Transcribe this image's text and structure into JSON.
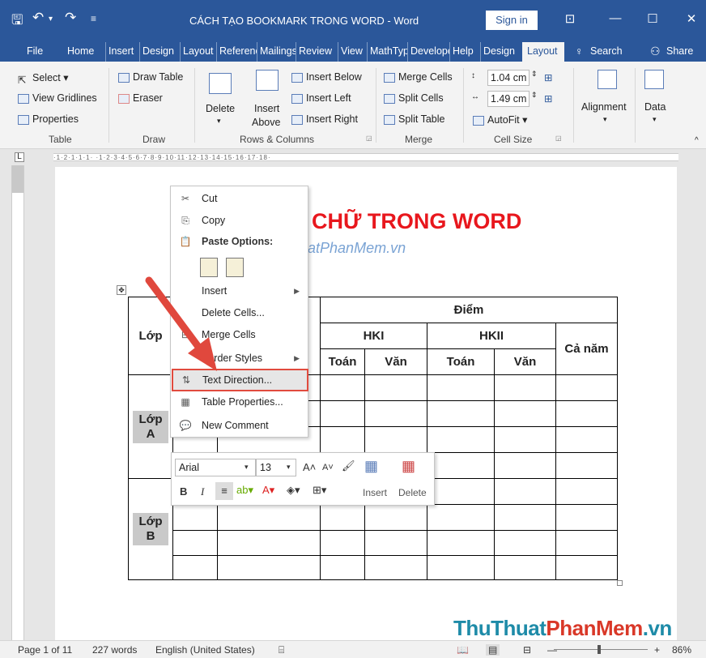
{
  "titlebar": {
    "title": "CÁCH TẠO BOOKMARK TRONG WORD  -  Word",
    "sign_in": "Sign in",
    "minimize": "☐",
    "close": "✕"
  },
  "tabs": [
    {
      "label": "File"
    },
    {
      "label": "Home"
    },
    {
      "label": "Insert"
    },
    {
      "label": "Design"
    },
    {
      "label": "Layout"
    },
    {
      "label": "References"
    },
    {
      "label": "Mailings"
    },
    {
      "label": "Review"
    },
    {
      "label": "View"
    },
    {
      "label": "MathType"
    },
    {
      "label": "Developer"
    },
    {
      "label": "Help"
    },
    {
      "label": "Design"
    },
    {
      "label": "Layout"
    }
  ],
  "tell_me": "Search",
  "share": "Share",
  "ribbon": {
    "table": {
      "select": "Select",
      "view_gridlines": "View Gridlines",
      "properties": "Properties",
      "group": "Table"
    },
    "draw": {
      "draw_table": "Draw Table",
      "eraser": "Eraser",
      "group": "Draw"
    },
    "rows_cols": {
      "delete": "Delete",
      "insert_above_1": "Insert",
      "insert_above_2": "Above",
      "insert_below": "Insert Below",
      "insert_left": "Insert Left",
      "insert_right": "Insert Right",
      "group": "Rows & Columns"
    },
    "merge": {
      "merge_cells": "Merge Cells",
      "split_cells": "Split Cells",
      "split_table": "Split Table",
      "group": "Merge"
    },
    "cell_size": {
      "height": "1.04 cm",
      "width": "1.49 cm",
      "autofit": "AutoFit",
      "group": "Cell Size"
    },
    "alignment": "Alignment",
    "data": "Data"
  },
  "document": {
    "heading": "Y CHỮ TRONG WORD",
    "subheading": "nuatPhanMem.vn",
    "table": {
      "lop": "Lớp",
      "diem": "Điểm",
      "hki": "HKI",
      "hkii": "HKII",
      "ca_nam": "Cả năm",
      "toan": "Toán",
      "van": "Văn",
      "lop_a": "Lớp A",
      "lop_b": "Lớp B"
    }
  },
  "context_menu": {
    "items": [
      {
        "label": "Cut",
        "icon": "scissors-icon"
      },
      {
        "label": "Copy",
        "icon": "copy-icon"
      },
      {
        "label": "Paste Options:",
        "icon": "paste-icon"
      },
      {
        "label": "Insert",
        "icon": ""
      },
      {
        "label": "Delete Cells...",
        "icon": ""
      },
      {
        "label": "Merge Cells",
        "icon": "merge-icon"
      },
      {
        "label": "Border Styles",
        "icon": ""
      },
      {
        "label": "Text Direction...",
        "icon": "text-direction-icon"
      },
      {
        "label": "Table Properties...",
        "icon": "table-properties-icon"
      },
      {
        "label": "New Comment",
        "icon": "comment-icon"
      }
    ]
  },
  "mini_toolbar": {
    "font": "Arial",
    "size": "13",
    "insert": "Insert",
    "delete": "Delete",
    "bold": "B",
    "italic": "I"
  },
  "status": {
    "page": "Page 1 of 11",
    "words": "227 words",
    "language": "English (United States)",
    "zoom": "86%"
  },
  "watermark": {
    "a": "ThuThuat",
    "b": "PhanMem",
    "c": ".vn"
  },
  "colors": {
    "accent": "#2b579a",
    "heading_red": "#e8171d",
    "highlight_border": "#e14b3e"
  }
}
